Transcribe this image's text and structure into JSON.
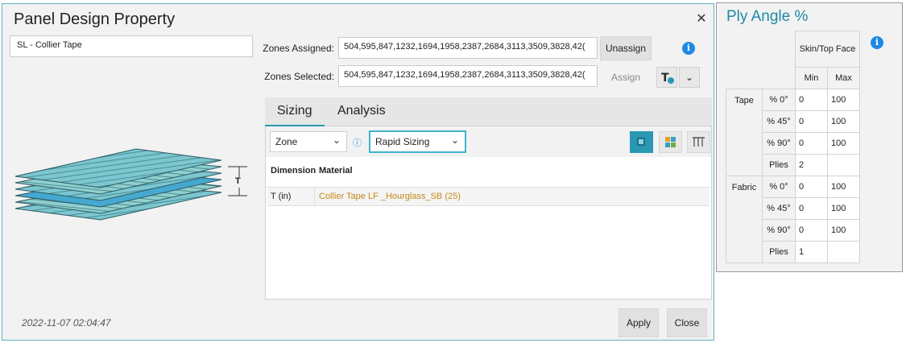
{
  "dialog": {
    "title": "Panel Design Property",
    "close_glyph": "✕",
    "name_value": "SL - Collier Tape",
    "zones_assigned_label": "Zones Assigned:",
    "zones_assigned_value": "504,595,847,1232,1694,1958,2387,2684,3113,3509,3828,42(",
    "unassign_label": "Unassign",
    "zones_selected_label": "Zones Selected:",
    "zones_selected_value": "504,595,847,1232,1694,1958,2387,2684,3113,3509,3828,42(",
    "assign_label": "Assign",
    "dimension_label": "T",
    "tabs": [
      {
        "label": "Sizing"
      },
      {
        "label": "Analysis"
      }
    ],
    "zone_select": "Zone",
    "sizing_select": "Rapid Sizing",
    "grid": {
      "headers": [
        "Dimension",
        "Material"
      ],
      "rows": [
        {
          "dimension": "T (in)",
          "material": "Collier Tape LF _Hourglass_SB (25)"
        }
      ]
    },
    "timestamp": "2022-11-07 02:04:47",
    "apply_label": "Apply",
    "close_label": "Close"
  },
  "ply_panel": {
    "title": "Ply Angle %",
    "column_header": "Skin/Top Face",
    "min_label": "Min",
    "max_label": "Max",
    "groups": [
      {
        "name": "Tape",
        "rows": [
          {
            "label": "% 0°",
            "min": "0",
            "max": "100"
          },
          {
            "label": "% 45°",
            "min": "0",
            "max": "100"
          },
          {
            "label": "% 90°",
            "min": "0",
            "max": "100"
          },
          {
            "label": "Plies",
            "min": "2",
            "max": ""
          }
        ]
      },
      {
        "name": "Fabric",
        "rows": [
          {
            "label": "% 0°",
            "min": "0",
            "max": "100"
          },
          {
            "label": "% 45°",
            "min": "0",
            "max": "100"
          },
          {
            "label": "% 90°",
            "min": "0",
            "max": "100"
          },
          {
            "label": "Plies",
            "min": "1",
            "max": ""
          }
        ]
      }
    ]
  },
  "colors": {
    "accent": "#2a97b4",
    "info": "#1e88e5",
    "material_link": "#c58a1a",
    "title_teal": "#1f8aa8"
  }
}
